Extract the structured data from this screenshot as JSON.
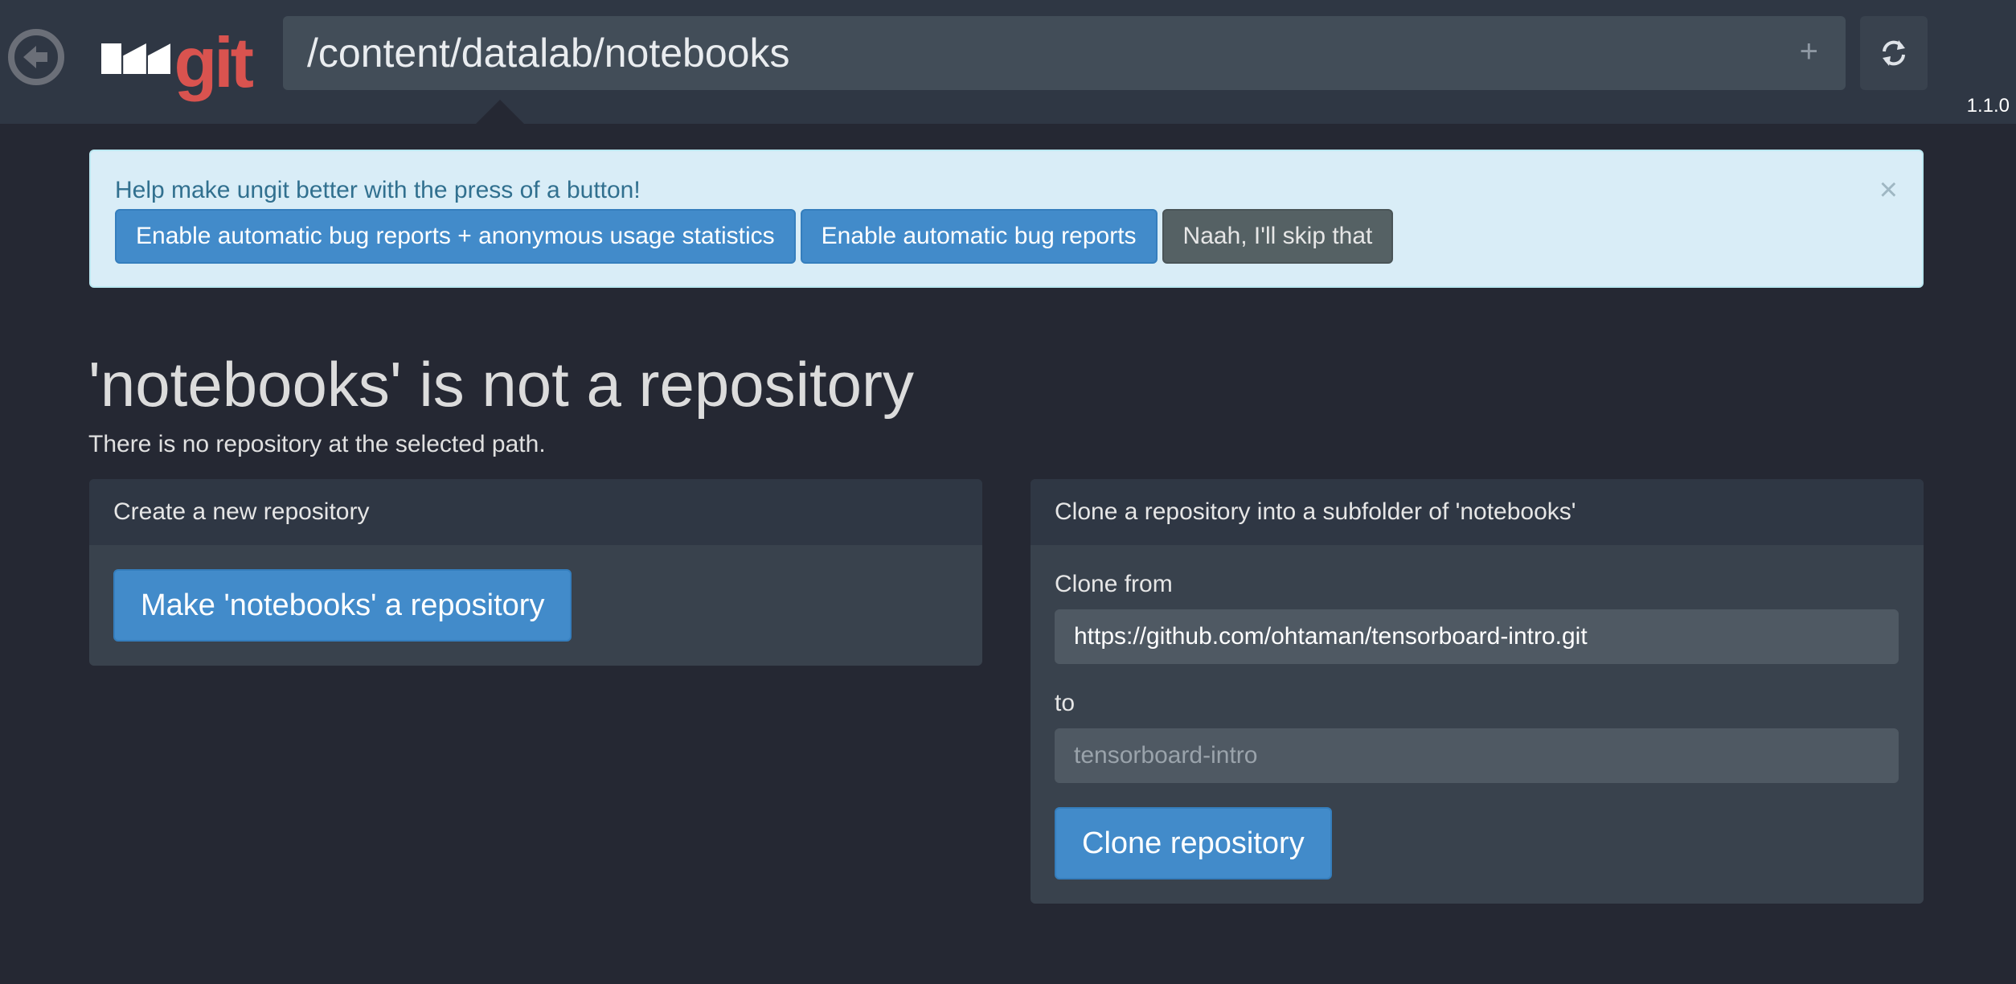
{
  "header": {
    "logo_text": "ungit",
    "path": "/content/datalab/notebooks",
    "add_symbol": "+",
    "version": "1.1.0"
  },
  "alert": {
    "message": "Help make ungit better with the press of a button!",
    "close_symbol": "×",
    "buttons": [
      "Enable automatic bug reports + anonymous usage statistics",
      "Enable automatic bug reports",
      "Naah, I'll skip that"
    ]
  },
  "main": {
    "title": "'notebooks' is not a repository",
    "subtitle": "There is no repository at the selected path."
  },
  "create_panel": {
    "heading": "Create a new repository",
    "button": "Make 'notebooks' a repository"
  },
  "clone_panel": {
    "heading": "Clone a repository into a subfolder of 'notebooks'",
    "from_label": "Clone from",
    "from_value": "https://github.com/ohtaman/tensorboard-intro.git",
    "to_label": "to",
    "to_placeholder": "tensorboard-intro",
    "button": "Clone repository"
  },
  "colors": {
    "background": "#252833",
    "header": "#2f3744",
    "primary": "#428bca",
    "alert_bg": "#d9edf7",
    "logo_red": "#d9534f"
  }
}
